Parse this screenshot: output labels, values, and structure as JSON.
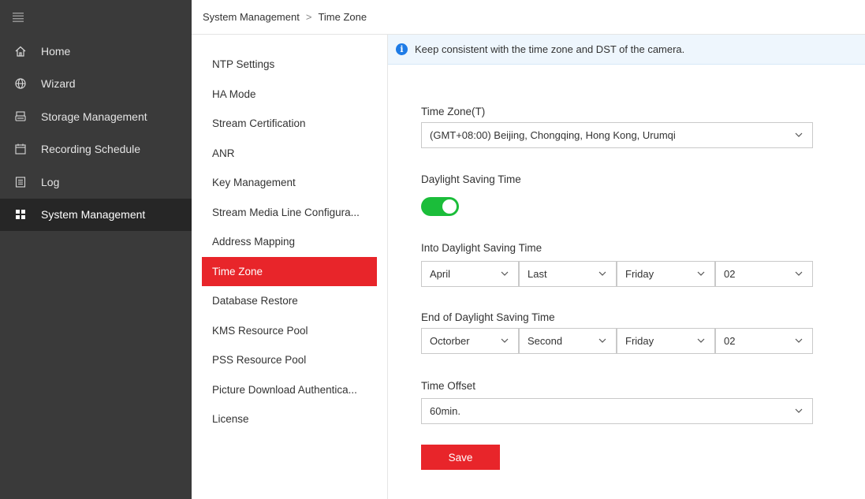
{
  "sidebar": {
    "items": [
      {
        "label": "Home",
        "icon": "home-icon"
      },
      {
        "label": "Wizard",
        "icon": "globe-icon"
      },
      {
        "label": "Storage Management",
        "icon": "storage-icon"
      },
      {
        "label": "Recording Schedule",
        "icon": "calendar-icon"
      },
      {
        "label": "Log",
        "icon": "log-icon"
      },
      {
        "label": "System Management",
        "icon": "grid-icon"
      }
    ]
  },
  "breadcrumb": {
    "parent": "System Management",
    "separator": ">",
    "current": "Time Zone"
  },
  "submenu": {
    "items": [
      "NTP Settings",
      "HA Mode",
      "Stream Certification",
      "ANR",
      "Key Management",
      "Stream Media Line Configura...",
      "Address Mapping",
      "Time Zone",
      "Database Restore",
      "KMS Resource Pool",
      "PSS Resource Pool",
      "Picture Download Authentica...",
      "License"
    ],
    "active": "Time Zone"
  },
  "info": {
    "icon": "info-icon",
    "text": "Keep consistent with the time zone and DST of the camera."
  },
  "form": {
    "time_zone_label": "Time Zone(T)",
    "time_zone_value": "(GMT+08:00) Beijing, Chongqing, Hong Kong, Urumqi",
    "dst_label": "Daylight Saving Time",
    "dst_enabled": true,
    "into_dst_label": "Into Daylight Saving Time",
    "into_dst": {
      "month": "April",
      "week": "Last",
      "day": "Friday",
      "hour": "02"
    },
    "end_dst_label": "End of Daylight Saving Time",
    "end_dst": {
      "month": "Octorber",
      "week": "Second",
      "day": "Friday",
      "hour": "02"
    },
    "time_offset_label": "Time Offset",
    "time_offset_value": "60min.",
    "save_label": "Save"
  },
  "colors": {
    "accent": "#e8252a",
    "sidebar_bg": "#3a3a3a",
    "toggle_on": "#1bbd3a",
    "info_blue": "#1e7be6"
  }
}
